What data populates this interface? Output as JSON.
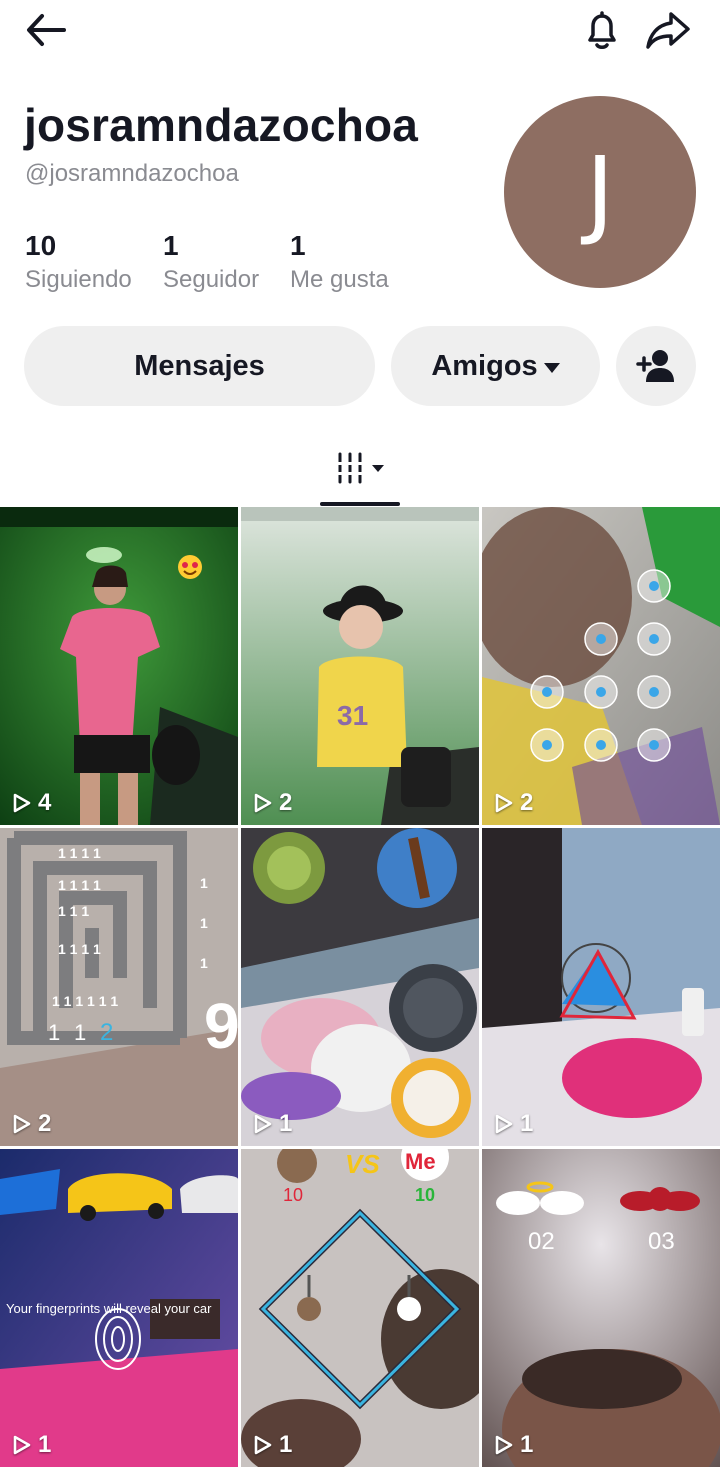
{
  "profile": {
    "username": "josramndazochoa",
    "handle": "@josramndazochoa",
    "avatar_initial": "J",
    "avatar_color": "#8e6e62"
  },
  "stats": [
    {
      "value": "10",
      "label": "Siguiendo"
    },
    {
      "value": "1",
      "label": "Seguidor"
    },
    {
      "value": "1",
      "label": "Me gusta"
    }
  ],
  "actions": {
    "messages_label": "Mensajes",
    "friends_label": "Amigos"
  },
  "icons": [
    "back-arrow-icon",
    "bell-icon",
    "share-icon",
    "add-friend-icon",
    "grid-icon",
    "play-icon"
  ],
  "videos": [
    {
      "views": "4"
    },
    {
      "views": "2"
    },
    {
      "views": "2"
    },
    {
      "views": "2"
    },
    {
      "views": "1"
    },
    {
      "views": "1"
    },
    {
      "views": "1"
    },
    {
      "views": "1"
    },
    {
      "views": "1"
    }
  ],
  "overlays": {
    "car_caption": "Your fingerprints will reveal your car",
    "score_left": "10",
    "score_right": "10",
    "vs_label": "VS",
    "me_label": "Me",
    "angel_num": "02",
    "devil_num": "03",
    "maze_num": "9"
  }
}
